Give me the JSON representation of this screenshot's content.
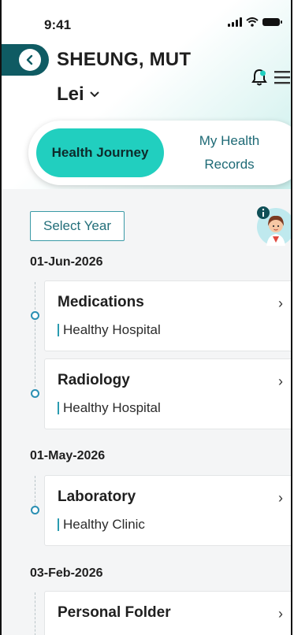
{
  "status_bar": {
    "time": "9:41",
    "icons": [
      "signal-icon",
      "wifi-icon",
      "battery-icon"
    ]
  },
  "header": {
    "name_line1": "SHEUNG, MUT",
    "name_line2": "Lei",
    "icons": [
      "back-icon",
      "chevron-down-icon",
      "bell-icon",
      "menu-icon"
    ]
  },
  "tabs": {
    "active": "Health Journey",
    "inactive_line1": "My Health",
    "inactive_line2": "Records"
  },
  "toolbar": {
    "select_year": "Select Year",
    "mascot_icon": "assistant-avatar-icon",
    "info_icon": "info-icon"
  },
  "timeline": [
    {
      "date": "01-Jun-2026",
      "items": [
        {
          "title": "Medications",
          "provider": "Healthy Hospital"
        },
        {
          "title": "Radiology",
          "provider": "Healthy Hospital"
        }
      ]
    },
    {
      "date": "01-May-2026",
      "items": [
        {
          "title": "Laboratory",
          "provider": "Healthy Clinic"
        }
      ]
    },
    {
      "date": "03-Feb-2026",
      "items": [
        {
          "title": "Personal Folder",
          "provider": ""
        }
      ]
    }
  ],
  "colors": {
    "teal_active": "#21cfbf",
    "dark_teal": "#0f5b63",
    "link_teal": "#236f7a",
    "timeline_dot": "#2a8fb3"
  }
}
